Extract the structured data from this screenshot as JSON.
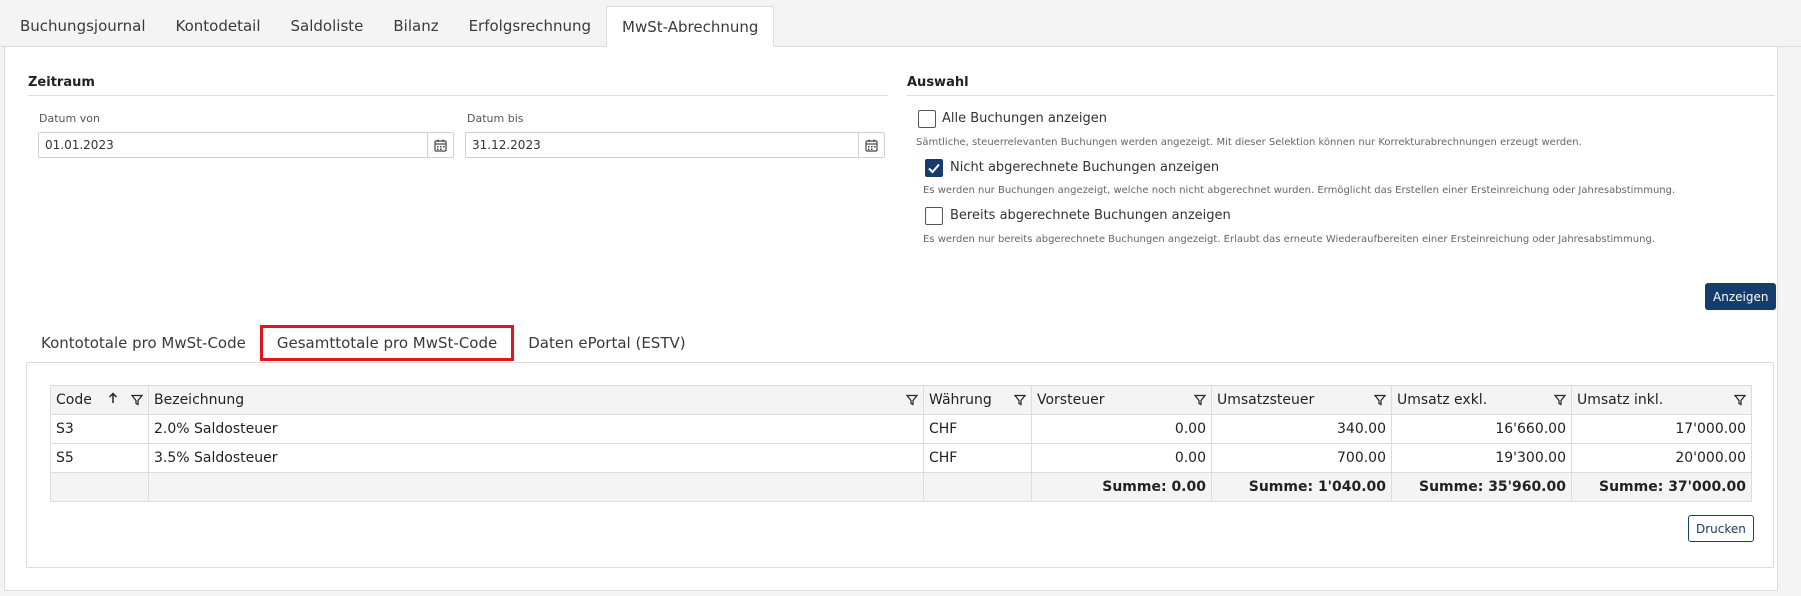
{
  "main_tabs": [
    "Buchungsjournal",
    "Kontodetail",
    "Saldoliste",
    "Bilanz",
    "Erfolgsrechnung",
    "MwSt-Abrechnung"
  ],
  "active_tab": "MwSt-Abrechnung",
  "zeitraum": {
    "title": "Zeitraum",
    "from_label": "Datum von",
    "from_value": "01.01.2023",
    "to_label": "Datum bis",
    "to_value": "31.12.2023"
  },
  "auswahl": {
    "title": "Auswahl",
    "options": [
      {
        "label": "Alle Buchungen anzeigen",
        "checked": false,
        "desc": "Sämtliche, steuerrelevanten Buchungen werden angezeigt. Mit dieser Selektion können nur Korrekturabrechnungen erzeugt werden."
      },
      {
        "label": "Nicht abgerechnete Buchungen anzeigen",
        "checked": true,
        "desc": "Es werden nur Buchungen angezeigt, welche noch nicht abgerechnet wurden. Ermöglicht das Erstellen einer Ersteinreichung oder Jahresabstimmung."
      },
      {
        "label": "Bereits abgerechnete Buchungen anzeigen",
        "checked": false,
        "desc": "Es werden nur bereits abgerechnete Buchungen angezeigt. Erlaubt das erneute Wiederaufbereiten einer Ersteinreichung oder Jahresabstimmung."
      }
    ],
    "show_button": "Anzeigen"
  },
  "subtabs": [
    "Kontototale pro MwSt-Code",
    "Gesamttotale pro MwSt-Code",
    "Daten ePortal (ESTV)"
  ],
  "table": {
    "headers": [
      "Code",
      "Bezeichnung",
      "Währung",
      "Vorsteuer",
      "Umsatzsteuer",
      "Umsatz exkl.",
      "Umsatz inkl."
    ],
    "rows": [
      [
        "S3",
        "2.0% Saldosteuer",
        "CHF",
        "0.00",
        "340.00",
        "16'660.00",
        "17'000.00"
      ],
      [
        "S5",
        "3.5% Saldosteuer",
        "CHF",
        "0.00",
        "700.00",
        "19'300.00",
        "20'000.00"
      ]
    ],
    "sums": [
      "Summe: 0.00",
      "Summe: 1'040.00",
      "Summe: 35'960.00",
      "Summe: 37'000.00"
    ]
  },
  "print_button": "Drucken",
  "colors": {
    "primary": "#163c6b",
    "highlight": "#e0161e"
  }
}
